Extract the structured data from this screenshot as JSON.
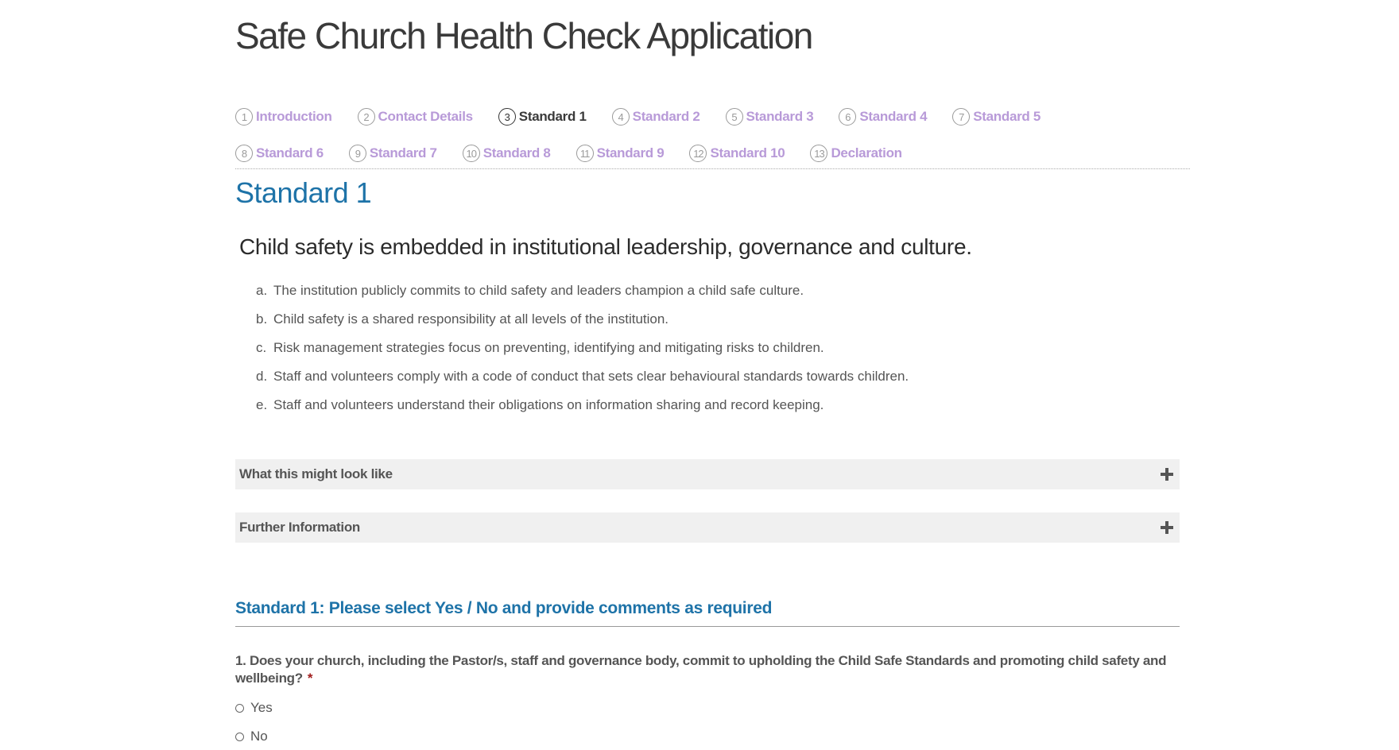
{
  "app": {
    "title": "Safe Church Health Check Application"
  },
  "steps": {
    "row1": [
      {
        "num": "1",
        "label": "Introduction"
      },
      {
        "num": "2",
        "label": "Contact Details"
      },
      {
        "num": "3",
        "label": "Standard 1",
        "active": true
      },
      {
        "num": "4",
        "label": "Standard 2"
      },
      {
        "num": "5",
        "label": "Standard 3"
      },
      {
        "num": "6",
        "label": "Standard 4"
      },
      {
        "num": "7",
        "label": "Standard 5"
      }
    ],
    "row2": [
      {
        "num": "8",
        "label": "Standard 6"
      },
      {
        "num": "9",
        "label": "Standard 7"
      },
      {
        "num": "10",
        "label": "Standard 8"
      },
      {
        "num": "11",
        "label": "Standard 9"
      },
      {
        "num": "12",
        "label": "Standard 10"
      },
      {
        "num": "13",
        "label": "Declaration"
      }
    ]
  },
  "section": {
    "title": "Standard 1",
    "statement": "Child safety is embedded in institutional leadership, governance and culture.",
    "criteria": [
      {
        "marker": "a.",
        "text": "The institution publicly commits to child safety and leaders champion a child safe culture."
      },
      {
        "marker": "b.",
        "text": "Child safety is a shared responsibility at all levels of the institution."
      },
      {
        "marker": "c.",
        "text": "Risk management strategies focus on preventing, identifying and mitigating risks to children."
      },
      {
        "marker": "d.",
        "text": "Staff and volunteers comply with a code of conduct that sets clear behavioural standards towards children."
      },
      {
        "marker": "e.",
        "text": "Staff and volunteers understand their obligations on information sharing and record keeping."
      }
    ]
  },
  "accordions": {
    "what_it_looks_like": "What this might look like",
    "further_info": "Further Information"
  },
  "form": {
    "heading": "Standard 1: Please select Yes / No and provide comments as required",
    "question1": {
      "text": "1. Does your church, including the Pastor/s, staff and governance body, commit to upholding the Child Safe Standards and promoting child safety and wellbeing?",
      "required_mark": "*",
      "options": [
        "Yes",
        "No"
      ]
    }
  },
  "icons": {
    "accordion_toggle": "plus-icon",
    "radio": "radio-button-icon"
  },
  "colors": {
    "heading_blue": "#1e73a8",
    "step_link_purple": "#b89ad8",
    "required_red": "#a01c1c",
    "accordion_bg": "#f0f0f0"
  }
}
